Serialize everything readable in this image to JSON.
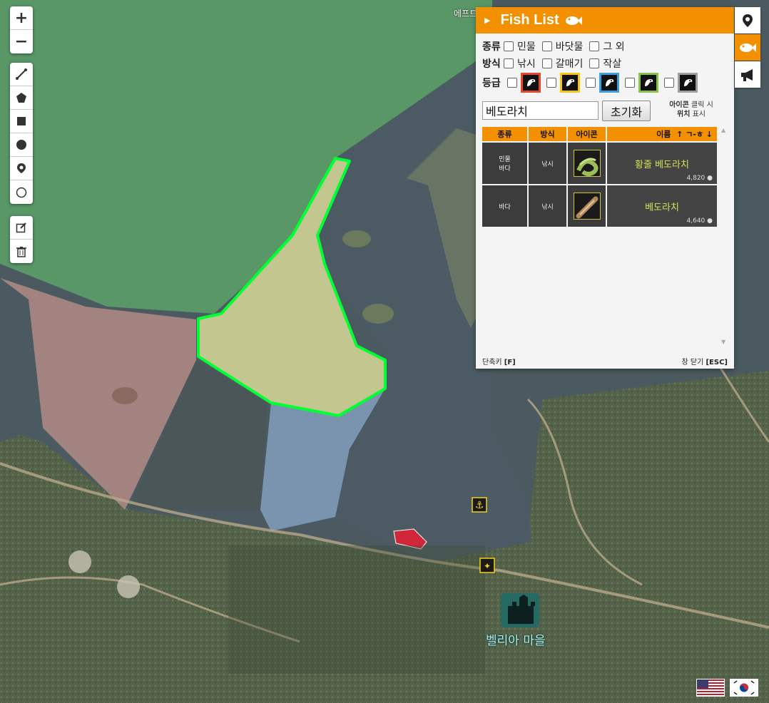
{
  "map": {
    "village_label": "벨리아 마을",
    "partial_label": "에프트"
  },
  "toolbar": {
    "zoom_in": "+",
    "zoom_out": "−"
  },
  "panel": {
    "title": "Fish List",
    "filters": {
      "type_label": "종류",
      "type_options": [
        "민물",
        "바닷물",
        "그 외"
      ],
      "method_label": "방식",
      "method_options": [
        "낚시",
        "갈매기",
        "작살"
      ],
      "grade_label": "등급",
      "grade_colors": [
        "#e8482a",
        "#f5c518",
        "#3aa0e0",
        "#8bc34a",
        "#9e9e9e"
      ]
    },
    "search": {
      "value": "베도라치"
    },
    "reset_label": "초기화",
    "hint": {
      "bold1": "아이콘",
      "text1": " 클릭 시",
      "bold2": "위치",
      "text2": " 표시"
    },
    "table": {
      "headers": [
        "종류",
        "방식",
        "아이콘",
        "이름"
      ],
      "sort_hint": "↑ ㄱ-ㅎ ↓",
      "rows": [
        {
          "type_line1": "민물",
          "type_line2": "바다",
          "method": "낚시",
          "name": "황줄 베도라치",
          "price": "4,820"
        },
        {
          "type_line1": "바다",
          "type_line2": "",
          "method": "낚시",
          "name": "베도라치",
          "price": "4,640"
        }
      ]
    },
    "shortcut_text": "단축키 ",
    "shortcut_key": "[F]",
    "close_text": "창 닫기 ",
    "close_key": "[ESC]"
  },
  "colors": {
    "accent": "#f39000",
    "selected_zone": "#00ff33"
  }
}
